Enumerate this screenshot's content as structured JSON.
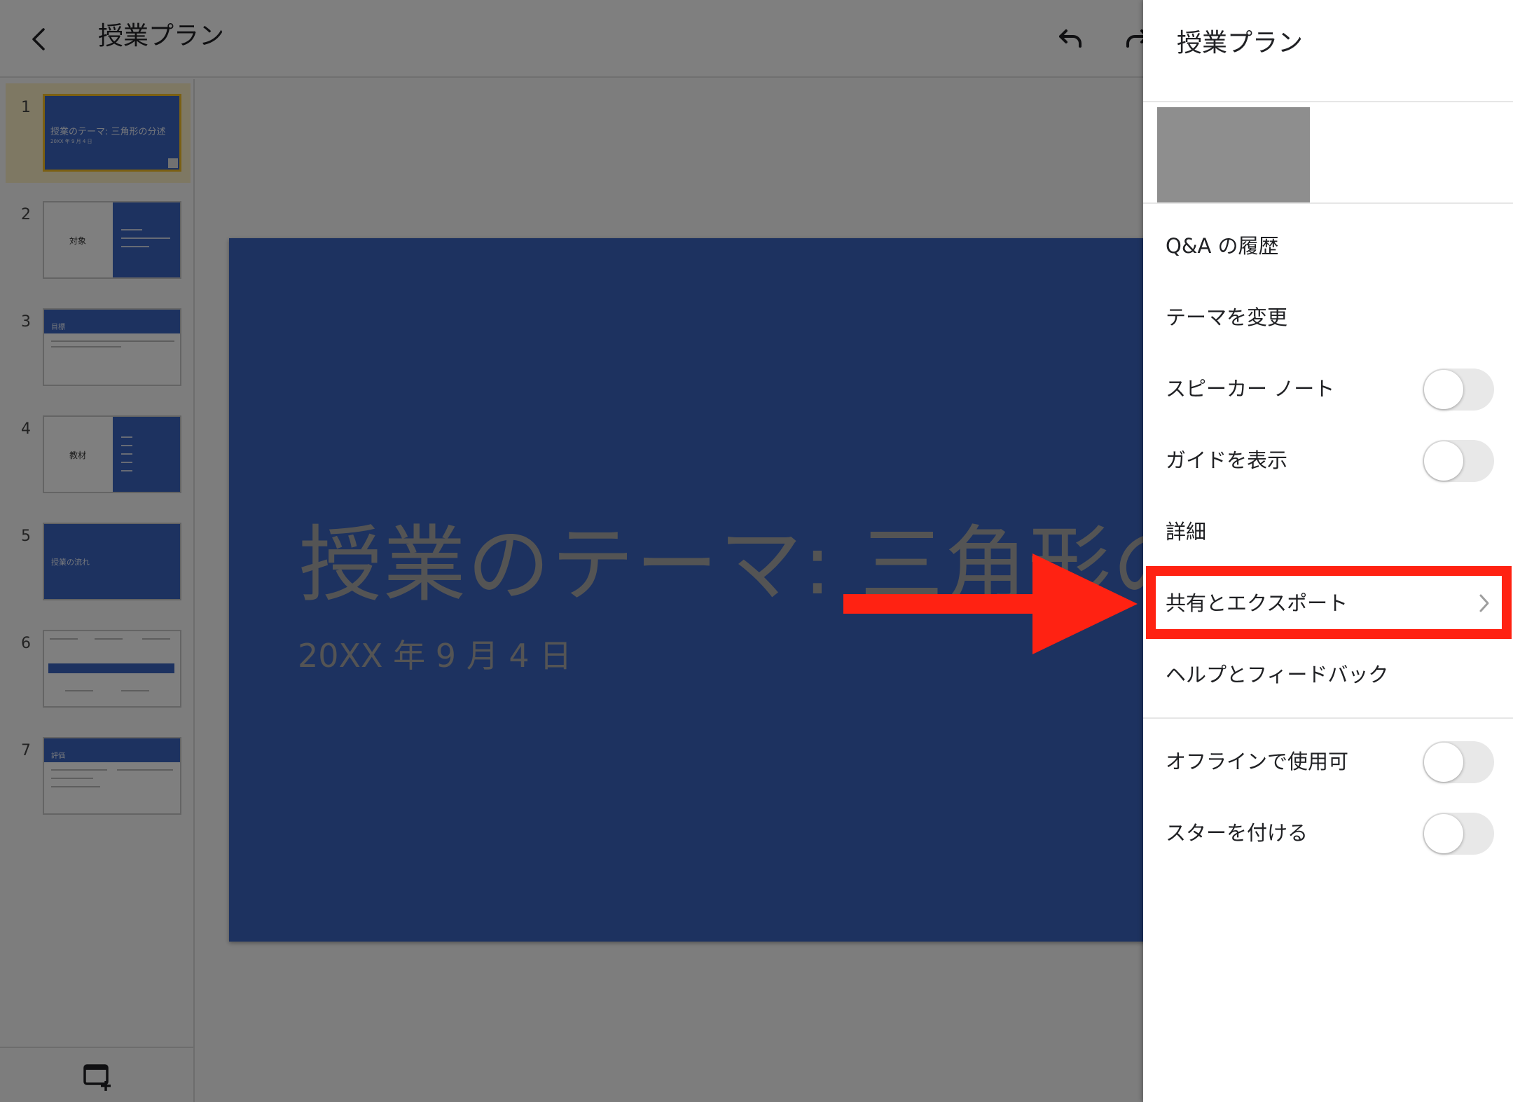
{
  "header": {
    "title": "授業プラン"
  },
  "slides": [
    {
      "num": "1",
      "title": "授業のテーマ: 三角形の分述",
      "subtitle": "20XX 年 9 月 4 日"
    },
    {
      "num": "2",
      "title": "対象"
    },
    {
      "num": "3",
      "title": "目標"
    },
    {
      "num": "4",
      "title": "教材"
    },
    {
      "num": "5",
      "title": "授業の流れ"
    },
    {
      "num": "6"
    },
    {
      "num": "7",
      "title": "評価"
    }
  ],
  "main_slide": {
    "title": "授業のテーマ: 三角形の",
    "subtitle": "20XX 年 9 月 4 日"
  },
  "panel": {
    "title": "授業プラン",
    "items": [
      {
        "label": "Q&A の履歴"
      },
      {
        "label": "テーマを変更"
      },
      {
        "label": "スピーカー ノート",
        "toggle": false
      },
      {
        "label": "ガイドを表示",
        "toggle": false
      },
      {
        "label": "詳細"
      },
      {
        "label": "共有とエクスポート",
        "has_chevron": true
      },
      {
        "label": "ヘルプとフィードバック"
      },
      {
        "label": "オフラインで使用可",
        "toggle": false
      },
      {
        "label": "スターを付ける",
        "toggle": false
      }
    ]
  },
  "colors": {
    "slide_blue": "#3a65c0",
    "highlight_red": "#ff2212",
    "selected_thumb": "#f6c026"
  },
  "icons": {
    "back": "chevron-left-icon",
    "undo": "undo-icon",
    "redo": "redo-icon",
    "add_slide": "add-slide-icon",
    "chevron": "chevron-right-icon"
  }
}
